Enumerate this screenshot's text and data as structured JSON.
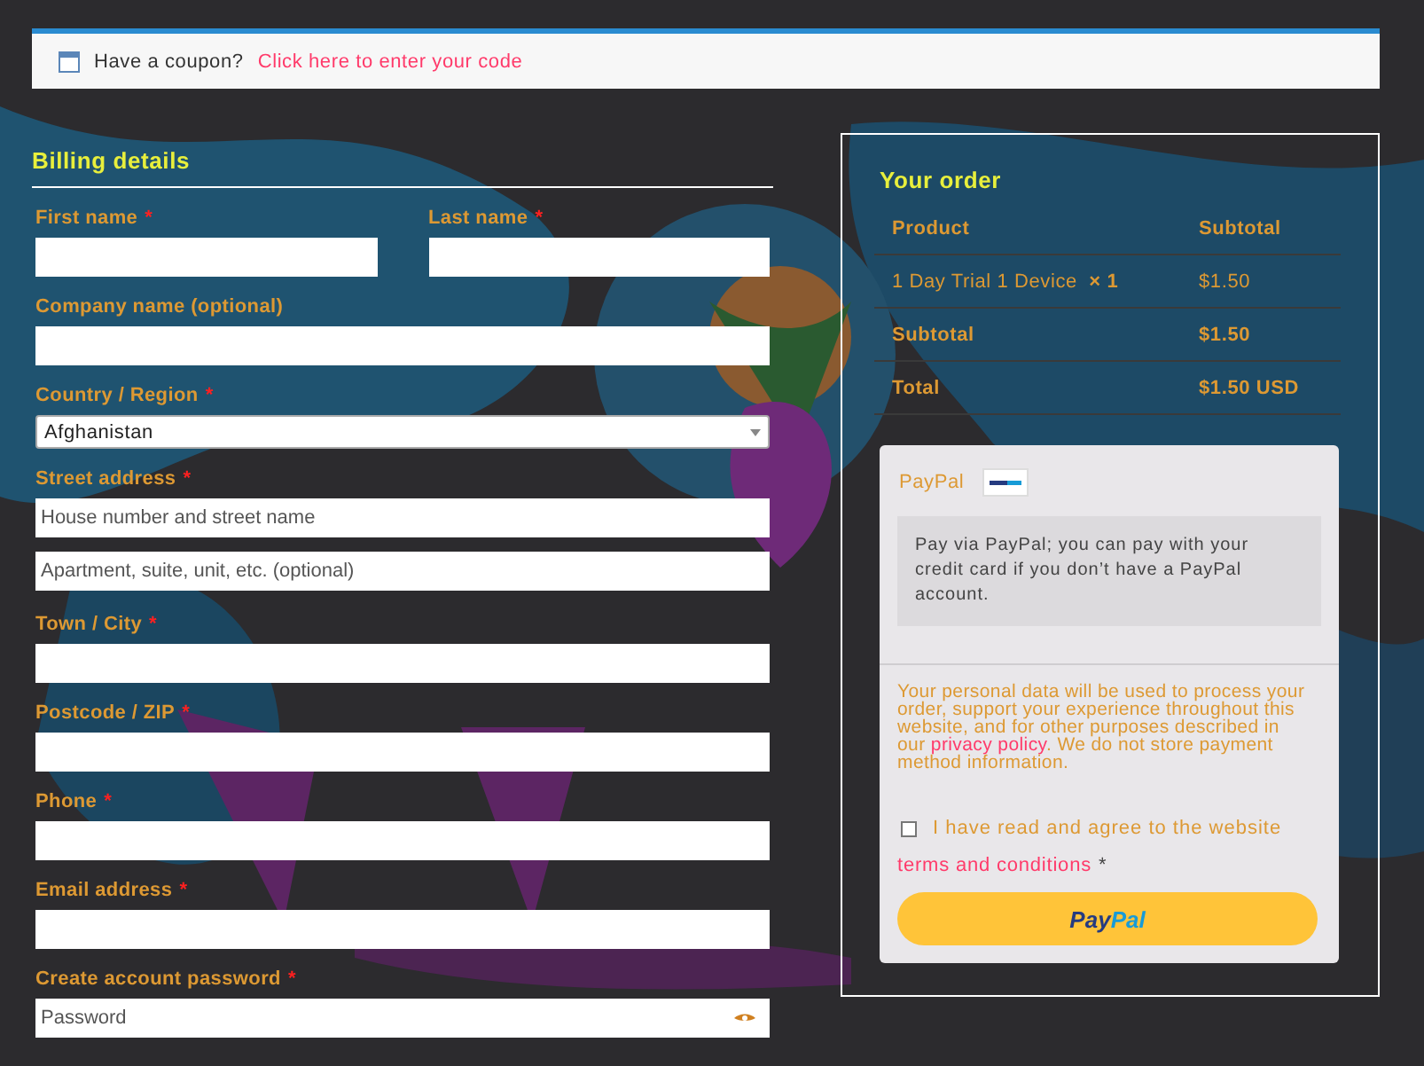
{
  "coupon": {
    "text": "Have a coupon?",
    "link": "Click here to enter your code"
  },
  "billing": {
    "title": "Billing details",
    "rows": [
      [
        {
          "kind": "text",
          "label": "First name",
          "required_mark": "*"
        },
        {
          "kind": "text",
          "label": "Last name",
          "required_mark": "*"
        }
      ],
      [
        {
          "kind": "text",
          "label": "Company name (optional)"
        }
      ],
      [
        {
          "kind": "select",
          "label": "Country / Region",
          "required_mark": "*",
          "value": "Afghanistan"
        }
      ],
      [
        {
          "kind": "text",
          "label": "Street address",
          "required_mark": "*",
          "placeholder": "House number and street name"
        }
      ],
      [
        {
          "kind": "text",
          "placeholder": "Apartment, suite, unit, etc. (optional)"
        }
      ],
      [
        {
          "kind": "text",
          "label": "Town / City",
          "required_mark": "*"
        }
      ],
      [
        {
          "kind": "text",
          "label": "Postcode / ZIP",
          "required_mark": "*"
        }
      ],
      [
        {
          "kind": "text",
          "label": "Phone",
          "required_mark": "*"
        }
      ],
      [
        {
          "kind": "text",
          "label": "Email address",
          "required_mark": "*"
        }
      ],
      [
        {
          "kind": "password",
          "label": "Create account password",
          "required_mark": "*",
          "placeholder": "Password"
        }
      ]
    ]
  },
  "order": {
    "title": "Your order",
    "columns": [
      "Product",
      "Subtotal"
    ],
    "rows": [
      {
        "kind": "item",
        "product": "1 Day Trial 1 Device",
        "quantity": "× 1",
        "amount": "$1.50"
      },
      {
        "kind": "total",
        "product": "Subtotal",
        "amount": "$1.50"
      },
      {
        "kind": "total",
        "product": "Total",
        "amount": "$1.50 USD"
      }
    ]
  },
  "payment": {
    "method": "PayPal",
    "description": "Pay via PayPal; you can pay with your credit card if you don’t have a PayPal account.",
    "privacy_text": "Your personal data will be used to process your order, support your experience throughout this website, and for other purposes described in our",
    "privacy_link": "privacy policy",
    "privacy_end": ". We do not store payment method information.",
    "terms": {
      "checked": false,
      "text": "I have read and agree to the website",
      "link": "terms and conditions",
      "required_mark": "*"
    },
    "button": [
      "Pay",
      "Pal"
    ]
  }
}
